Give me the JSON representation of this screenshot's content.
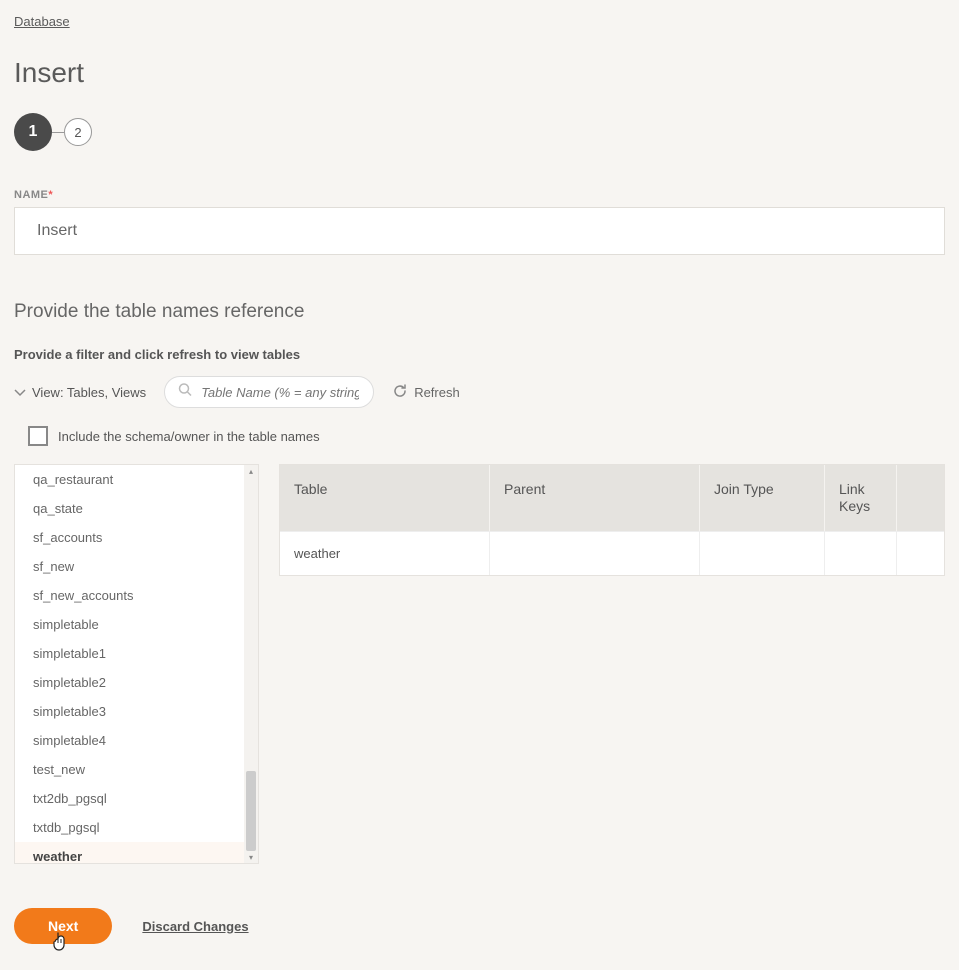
{
  "breadcrumb": {
    "database": "Database"
  },
  "page_title": "Insert",
  "steps": [
    "1",
    "2"
  ],
  "name_field": {
    "label": "NAME",
    "value": "Insert"
  },
  "section_title": "Provide the table names reference",
  "hint": "Provide a filter and click refresh to view tables",
  "view_toggle": "View: Tables, Views",
  "search_placeholder": "Table Name (% = any string)",
  "refresh_label": "Refresh",
  "include_schema_label": "Include the schema/owner in the table names",
  "include_schema_checked": false,
  "tables": [
    "qa_restaurant",
    "qa_state",
    "sf_accounts",
    "sf_new",
    "sf_new_accounts",
    "simpletable",
    "simpletable1",
    "simpletable2",
    "simpletable3",
    "simpletable4",
    "test_new",
    "txt2db_pgsql",
    "txtdb_pgsql",
    "weather"
  ],
  "selected_table": "weather",
  "grid": {
    "headers": {
      "table": "Table",
      "parent": "Parent",
      "join": "Join Type",
      "link": "Link Keys"
    },
    "rows": [
      {
        "table": "weather",
        "parent": "",
        "join": "",
        "link": ""
      }
    ]
  },
  "footer": {
    "next": "Next",
    "discard": "Discard Changes"
  }
}
